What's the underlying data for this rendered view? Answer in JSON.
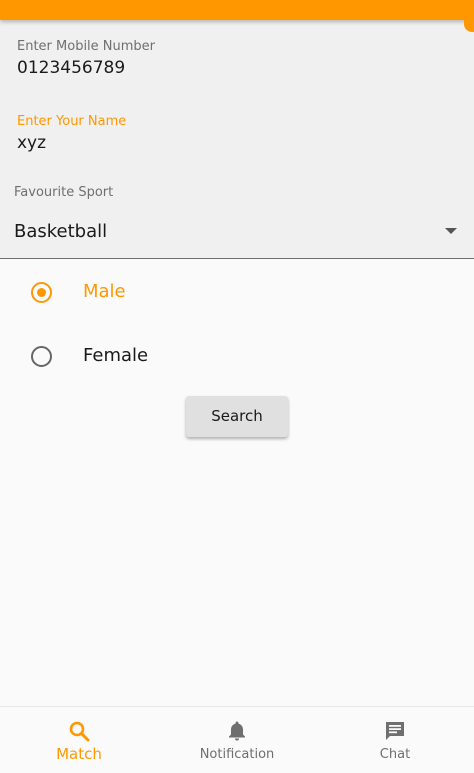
{
  "form": {
    "mobile": {
      "label": "Enter Mobile Number",
      "value": "0123456789"
    },
    "name": {
      "label": "Enter Your Name",
      "value": "xyz"
    },
    "sport": {
      "label": "Favourite Sport",
      "selected": "Basketball"
    }
  },
  "gender": {
    "options": [
      {
        "label": "Male",
        "selected": true
      },
      {
        "label": "Female",
        "selected": false
      }
    ]
  },
  "search_button": {
    "label": "Search"
  },
  "bottom_nav": {
    "items": [
      {
        "label": "Match",
        "icon": "search-icon",
        "active": true
      },
      {
        "label": "Notification",
        "icon": "bell-icon",
        "active": false
      },
      {
        "label": "Chat",
        "icon": "chat-icon",
        "active": false
      }
    ]
  },
  "colors": {
    "accent": "#ff9800",
    "field_background": "#f0f0f0",
    "inactive": "#6f6f6f"
  }
}
